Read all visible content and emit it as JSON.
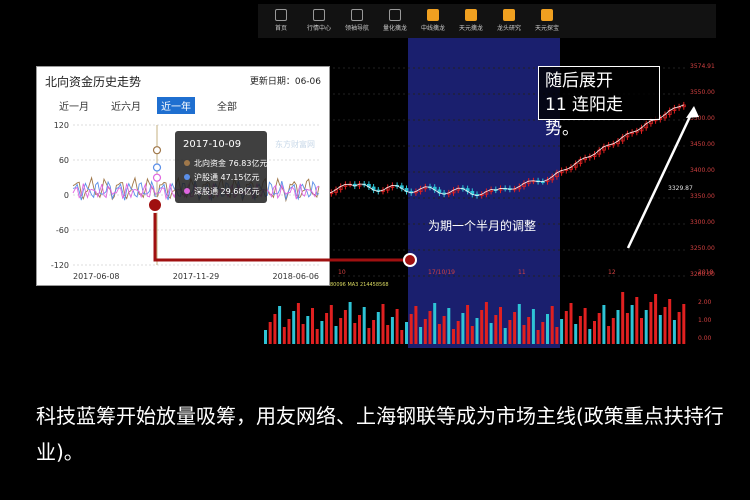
{
  "toolbar": {
    "items": [
      {
        "label": "首页",
        "icon": "home-icon"
      },
      {
        "label": "行情中心",
        "icon": "market-icon"
      },
      {
        "label": "领袖导航",
        "icon": "nav-icon"
      },
      {
        "label": "量化擒龙",
        "icon": "dragon-icon"
      },
      {
        "label": "中线擒龙",
        "icon": "mid-dragon-icon"
      },
      {
        "label": "天元擒龙",
        "icon": "tianyuan-icon"
      },
      {
        "label": "龙头研究",
        "icon": "research-icon"
      },
      {
        "label": "天元探宝",
        "icon": "treasure-icon"
      }
    ]
  },
  "main_chart": {
    "price_labels": [
      "3574.91",
      "3550.00",
      "3500.00",
      "3450.00",
      "3400.00",
      "3350.00",
      "3300.00",
      "3250.00",
      "3200.00"
    ],
    "current_price": "3329.87",
    "volume_labels": [
      "2.00",
      "1.00",
      "0.00"
    ],
    "x_labels": [
      "10",
      "17/10/19",
      "11",
      "12",
      "2018"
    ],
    "ma_info": "MA1 235051472  MA2 214480096  MA3 214458568",
    "colors": {
      "up": "#e02020",
      "down": "#2ec4d6",
      "shade": "#1a1f6e",
      "ma": "#f5f5f5"
    }
  },
  "inset": {
    "title": "北向资金历史走势",
    "updated": "更新日期：06-06",
    "tabs": [
      "近一月",
      "近六月",
      "近一年",
      "全部"
    ],
    "active_tab": "近一年",
    "y_ticks": [
      "120",
      "60",
      "0",
      "-60",
      "-120"
    ],
    "x_ticks": [
      "2017-06-08",
      "2017-11-29",
      "2018-06-06"
    ],
    "watermark": "东方财富网",
    "tooltip": {
      "date": "2017-10-09",
      "rows": [
        "北向资金 76.83亿元",
        "沪股通 47.15亿元",
        "深股通 29.68亿元"
      ],
      "colors": [
        "#a0784a",
        "#5b8fe8",
        "#e066e0"
      ]
    }
  },
  "annotations": {
    "note": [
      "随后展开",
      "11 连阳走势。"
    ],
    "consolidation": "为期一个半月的调整"
  },
  "caption": "科技蓝筹开始放量吸筹，用友网络、上海钢联等成为市场主线(政策重点扶持行业)。",
  "chart_data": [
    {
      "type": "line",
      "title": "北向资金历史走势",
      "series": [
        {
          "name": "北向资金"
        },
        {
          "name": "沪股通"
        },
        {
          "name": "深股通"
        }
      ],
      "ylim": [
        -120,
        120
      ],
      "x": [
        "2017-06-08",
        "2017-11-29",
        "2018-06-06"
      ],
      "highlight": {
        "date": "2017-10-09",
        "values": {
          "北向资金": 76.83,
          "沪股通": 47.15,
          "深股通": 29.68
        }
      }
    }
  ]
}
